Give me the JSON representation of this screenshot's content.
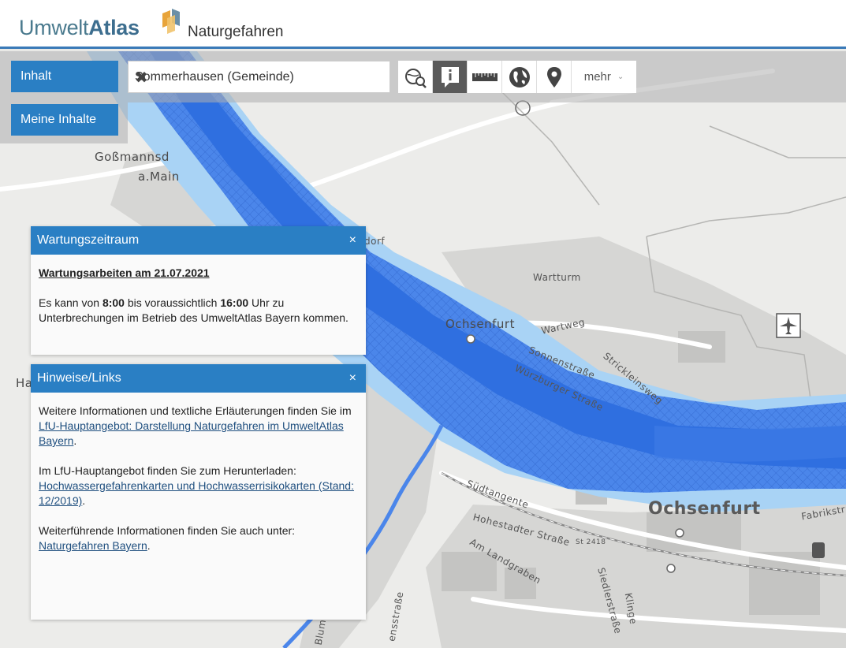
{
  "header": {
    "logo_part1": "Umwelt",
    "logo_part2": "Atlas",
    "app_title": "Naturgefahren"
  },
  "nav": {
    "inhalt_label": "Inhalt",
    "meine_inhalte_label": "Meine Inhalte"
  },
  "search": {
    "value": "Sommerhausen (Gemeinde)",
    "clear_glyph": "✖"
  },
  "tools": {
    "mehr_label": "mehr",
    "mehr_chevron": "⌄",
    "icons": [
      "map-search-icon",
      "info-icon",
      "ruler-icon",
      "globe-icon",
      "location-pin-icon"
    ]
  },
  "map": {
    "labels": {
      "gossmannsdorf": "Goßmannsd",
      "amain": "a.Main",
      "dorf": "dorf",
      "warttum": "Wartturm",
      "ochsenfurt_small": "Ochsenfurt",
      "wartweg": "Wartweg",
      "sonnenstrasse": "Sonnenstraße",
      "strickleinsweg": "Strickleinsweg",
      "wuerzburger": "Würzburger Straße",
      "suedtangente": "Südtangente",
      "hohestadter": "Hohestadter Straße",
      "am_landgraben": "Am Landgraben",
      "ochsenfurt_big": "Ochsenfurt",
      "fabrikstr": "Fabrikstra",
      "ha": "Ha",
      "klinge": "Klinge",
      "siedlerstr": "Siedlerstraße",
      "st2418": "St 2418",
      "blum": "Blum",
      "ensstrasse": "ensstraße"
    },
    "colors": {
      "flood_dark": "#2f6fe0",
      "flood_mid": "#4b86ea",
      "flood_light": "#a9d3f5"
    }
  },
  "panels": {
    "wartung": {
      "title": "Wartungszeitraum",
      "close": "×",
      "heading": "Wartungsarbeiten am 21.07.2021",
      "text_pre": "Es kann von ",
      "time_start": "8:00",
      "text_mid": " bis voraussichtlich ",
      "time_end": "16:00",
      "text_post": " Uhr zu Unterbrechungen im Betrieb des UmweltAtlas Bayern kommen."
    },
    "hinweise": {
      "title": "Hinweise/Links",
      "close": "×",
      "p1_text": "Weitere Informationen und textliche Erläuterungen finden Sie im ",
      "p1_link": "LfU-Hauptangebot: Darstellung Naturgefahren im UmweltAtlas Bayern",
      "p1_end": ".",
      "p2_text": "Im LfU-Hauptangebot finden Sie zum Herunterladen: ",
      "p2_link": "Hochwassergefahrenkarten und Hochwasserrisikokarten (Stand: 12/2019)",
      "p2_end": ".",
      "p3_text": "Weiterführende Informationen finden Sie auch unter: ",
      "p3_link": "Naturgefahren Bayern",
      "p3_end": "."
    }
  }
}
